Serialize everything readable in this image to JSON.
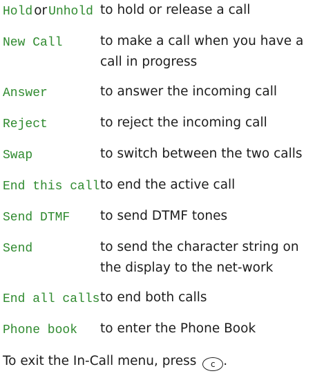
{
  "entries": [
    {
      "command": "Hold",
      "joiner": "or",
      "command2": "Unhold",
      "description": "to hold or release a call"
    },
    {
      "command": "New Call",
      "description": "to make a call when you have a call in progress"
    },
    {
      "command": "Answer",
      "description": "to answer the incoming call"
    },
    {
      "command": "Reject",
      "description": "to reject the incoming call"
    },
    {
      "command": "Swap",
      "description": "to switch between the two calls"
    },
    {
      "command": "End this call",
      "description": "to end the active call"
    },
    {
      "command": "Send DTMF",
      "description": "to send DTMF tones"
    },
    {
      "command": "Send",
      "description": "to send the character string on the display to the net-work"
    },
    {
      "command": "End all calls",
      "description": "to end both calls"
    },
    {
      "command": "Phone book",
      "description": "to enter the Phone Book"
    }
  ],
  "footer": {
    "text": "To exit the In-Call menu, press",
    "key_label": "c",
    "key_icon": "c-key-icon",
    "end": "."
  }
}
